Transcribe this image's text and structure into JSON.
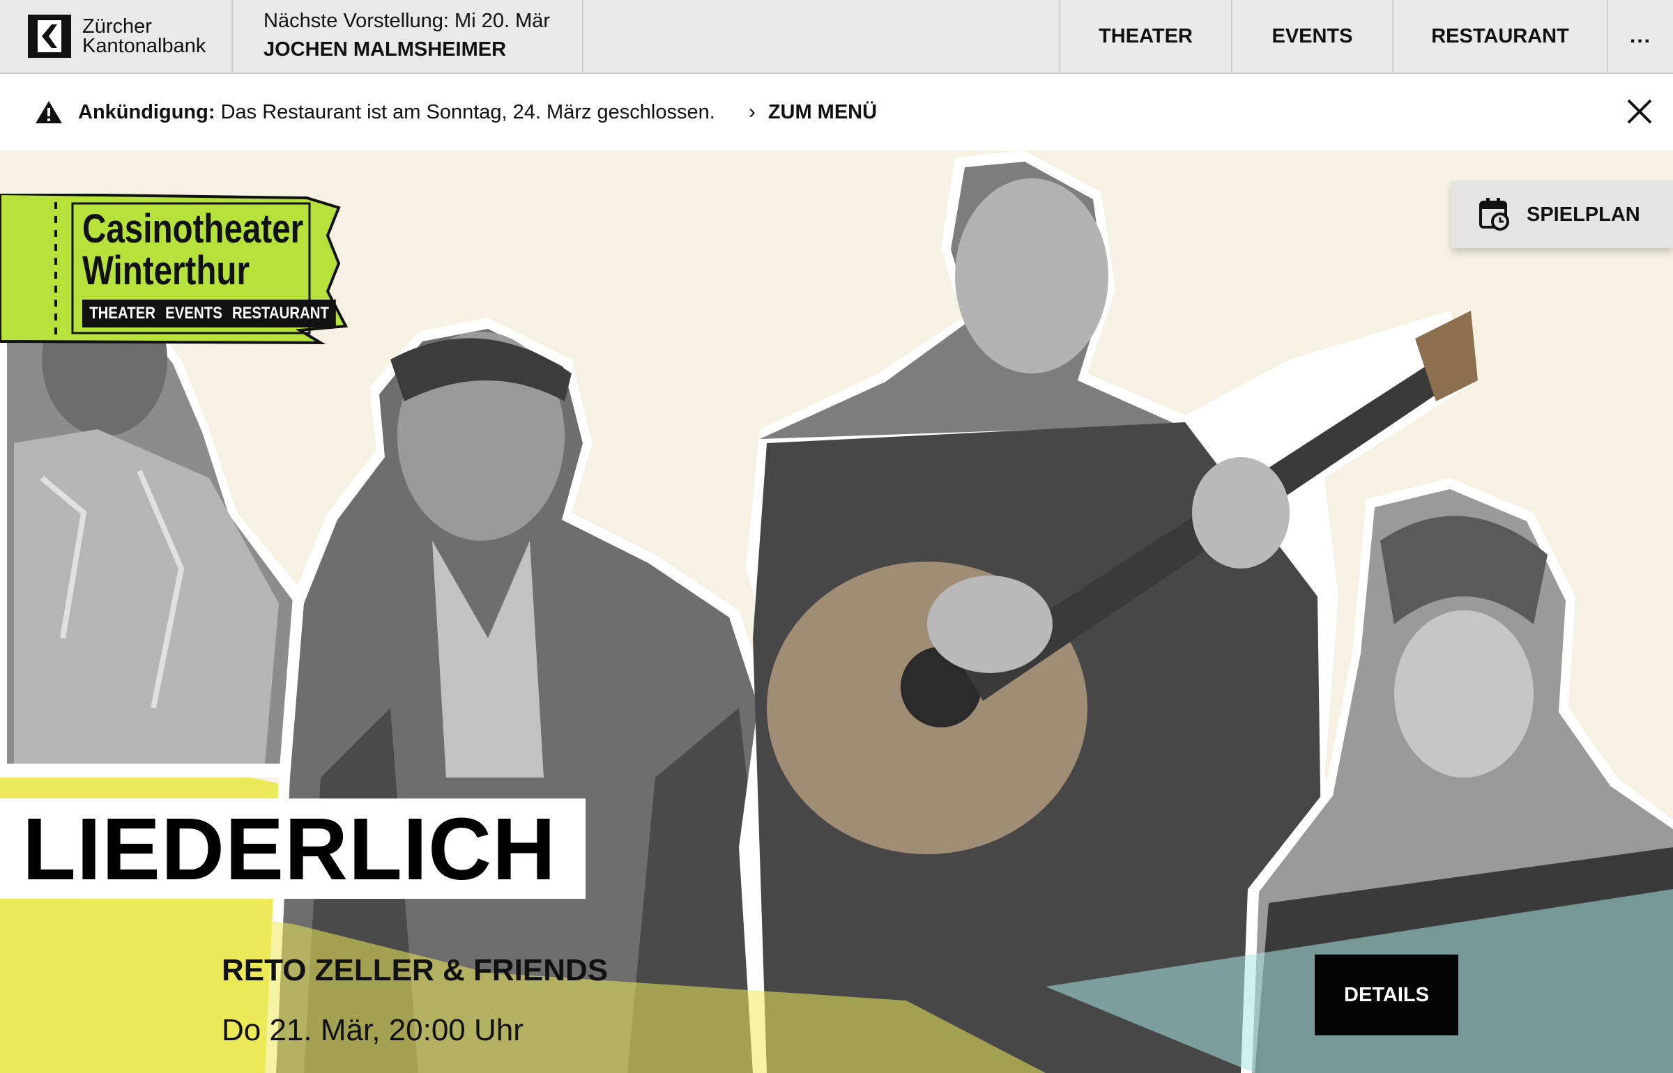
{
  "topbar": {
    "sponsor_line1": "Zürcher",
    "sponsor_line2": "Kantonalbank",
    "next_label": "Nächste Vorstellung: Mi 20. Mär",
    "next_title": "JOCHEN MALMSHEIMER",
    "nav": [
      "THEATER",
      "EVENTS",
      "RESTAURANT",
      "..."
    ]
  },
  "announcement": {
    "label": "Ankündigung:",
    "text": " Das Restaurant ist am Sonntag, 24. März geschlossen.",
    "link": "ZUM MENÜ"
  },
  "logo": {
    "line1": "Casinotheater",
    "line2": "Winterthur",
    "sub": "THEATER EVENTS RESTAURANT"
  },
  "spielplan": "SPIELPLAN",
  "hero": {
    "title": "LIEDERLICH",
    "artist": "RETO ZELLER & FRIENDS",
    "date": "Do 21. Mär, 20:00 Uhr",
    "details": "DETAILS"
  },
  "colors": {
    "accent_yellow": "#ecea5a",
    "accent_cyan": "#a8e6e2",
    "logo_green": "#b7e23b",
    "background": "#f6f1e3"
  }
}
